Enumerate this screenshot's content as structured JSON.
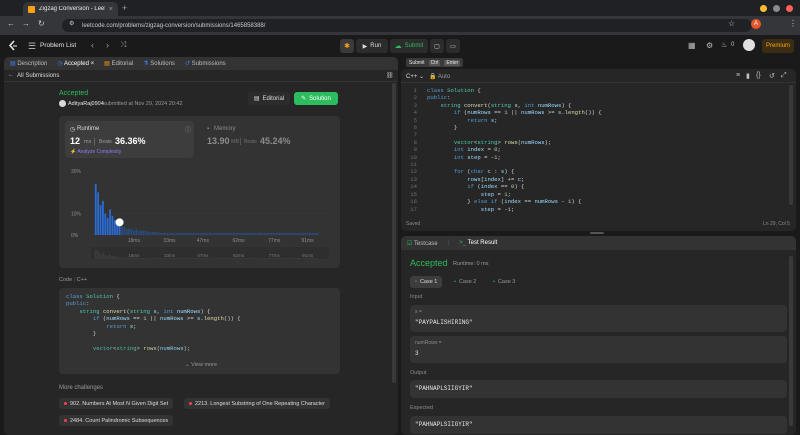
{
  "browser": {
    "tab_title": "Zigzag Conversion - Leet",
    "url": "leetcode.com/problems/zigzag-conversion/submissions/1465858388/"
  },
  "topbar": {
    "problem_list": "Problem List",
    "run": "Run",
    "submit": "Submit",
    "streak": "0",
    "premium": "Premium"
  },
  "left_tabs": [
    "Description",
    "Accepted",
    "Editorial",
    "Solutions",
    "Submissions"
  ],
  "tooltip": [
    "Submit",
    "Ctrl",
    "Enter"
  ],
  "submission": {
    "back": "All Submissions",
    "status": "Accepted",
    "user": "AdityaRaj0904",
    "submitted": "submitted at Nov 29, 2024 20:42",
    "editorial_btn": "Editorial",
    "solution_btn": "Solution",
    "runtime_label": "Runtime",
    "runtime_value": "12",
    "runtime_unit": "ms",
    "beats_label": "Beats",
    "runtime_beats": "36.36%",
    "analyze": "Analyze Complexity",
    "memory_label": "Memory",
    "memory_value": "13.90",
    "memory_unit": "MB",
    "memory_beats": "45.24%"
  },
  "chart_data": {
    "type": "bar",
    "title": "Runtime distribution",
    "ylabel": "",
    "y_ticks": [
      "30%",
      "10%",
      "0%"
    ],
    "x_ticks": [
      "18ms",
      "33ms",
      "47ms",
      "62ms",
      "77ms",
      "91ms"
    ],
    "x_tick_values": [
      18,
      33,
      47,
      62,
      77,
      91
    ],
    "xlim": [
      0,
      100
    ],
    "ylim": [
      0,
      30
    ],
    "x": [
      2,
      3,
      4,
      5,
      6,
      7,
      8,
      9,
      10,
      11,
      12,
      13,
      14,
      15,
      16,
      17,
      18,
      19,
      20,
      21,
      22,
      23,
      24,
      25,
      26,
      27,
      28,
      29,
      30,
      31,
      32,
      33,
      34,
      35,
      36,
      37,
      38,
      39,
      40,
      41,
      42,
      43,
      44,
      45,
      46,
      47,
      48,
      49,
      50,
      51,
      52,
      53,
      54,
      55,
      56,
      57,
      58,
      59,
      60,
      61,
      62,
      63,
      64,
      65,
      66,
      67,
      68,
      69,
      70,
      71,
      72,
      73,
      74,
      75,
      76,
      77,
      78,
      79,
      80,
      81,
      82,
      83,
      84,
      85,
      86,
      87,
      88,
      89,
      90,
      91,
      92,
      93,
      94,
      95
    ],
    "values": [
      24,
      20,
      14,
      16,
      10,
      8,
      12,
      9,
      7,
      6,
      5,
      4,
      4,
      3,
      3,
      3,
      2,
      3,
      2,
      2,
      2,
      2,
      1.5,
      1.5,
      1.5,
      1.5,
      1.5,
      1,
      1,
      1,
      1,
      1,
      1,
      1,
      1,
      1,
      1,
      1,
      1,
      1,
      1,
      1,
      1,
      1,
      1,
      1,
      1,
      1,
      1,
      1,
      1,
      1,
      1,
      1,
      1,
      1,
      1,
      1,
      1,
      1,
      1,
      1,
      1,
      1,
      1,
      1,
      1,
      1,
      1,
      1,
      1,
      1,
      1,
      1,
      1,
      1,
      1,
      1,
      1,
      1,
      1,
      1,
      1,
      1,
      1,
      1,
      1,
      1,
      1,
      1,
      1,
      1,
      1,
      1
    ],
    "highlight_x": 12,
    "overview_ticks": [
      "18ms",
      "33ms",
      "47ms",
      "62ms",
      "77ms",
      "91ms"
    ]
  },
  "code_section": {
    "label": "Code",
    "lang": "C++",
    "view_more": "View more"
  },
  "more": {
    "title": "More challenges",
    "items": [
      "902. Numbers At Most N Given Digit Set",
      "2213. Longest Substring of One Repeating Character",
      "2484. Count Palindromic Subsequences"
    ]
  },
  "editor": {
    "lang": "C++",
    "mode": "Auto",
    "saved": "Saved",
    "cursor": "Ln 29, Col 5",
    "line_numbers": [
      "1",
      "2",
      "3",
      "4",
      "5",
      "6",
      "7",
      "8",
      "9",
      "10",
      "11",
      "12",
      "13",
      "14",
      "15",
      "16",
      "17"
    ]
  },
  "results": {
    "testcase_tab": "Testcase",
    "result_tab": "Test Result",
    "status": "Accepted",
    "runtime": "Runtime: 0 ms",
    "cases": [
      "Case 1",
      "Case 2",
      "Case 3"
    ],
    "input_label": "Input",
    "s_label": "s =",
    "s_value": "\"PAYPALISHIRING\"",
    "numrows_label": "numRows =",
    "numrows_value": "3",
    "output_label": "Output",
    "output_value": "\"PAHNAPLSIIGYIR\"",
    "expected_label": "Expected",
    "expected_value": "\"PAHNAPLSIIGYIR\""
  },
  "colors": {
    "accent_green": "#2cbb5d",
    "brand_orange": "#ffa116",
    "chart_blue": "#2a6bd5"
  }
}
